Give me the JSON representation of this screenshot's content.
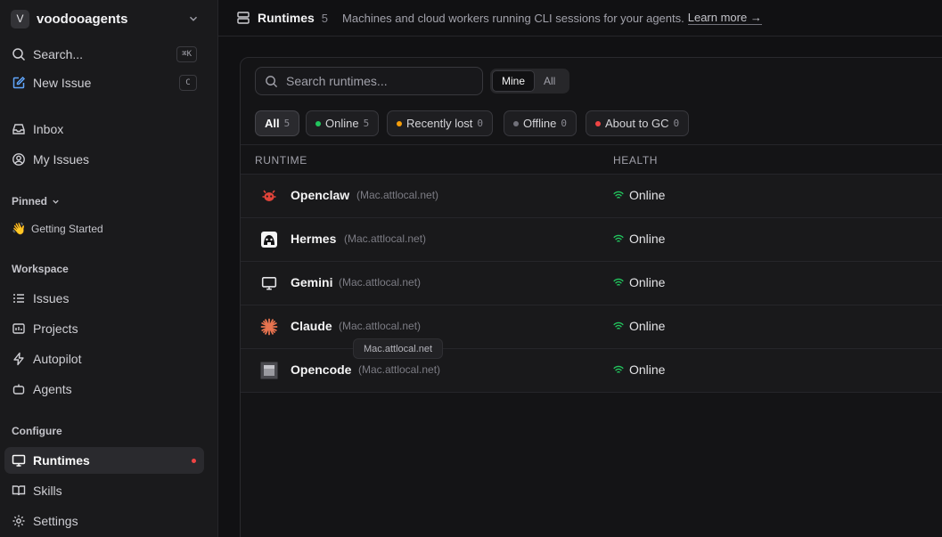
{
  "workspace": {
    "initial": "V",
    "name": "voodooagents"
  },
  "sidebar": {
    "search": {
      "label": "Search...",
      "shortcut": "⌘K"
    },
    "new_issue": {
      "label": "New Issue",
      "shortcut": "C"
    },
    "inbox": "Inbox",
    "my_issues": "My Issues",
    "pinned_label": "Pinned",
    "pinned_items": [
      {
        "emoji": "👋",
        "label": "Getting Started"
      }
    ],
    "workspace_label": "Workspace",
    "workspace_items": [
      "Issues",
      "Projects",
      "Autopilot",
      "Agents"
    ],
    "configure_label": "Configure",
    "configure_items": [
      "Runtimes",
      "Skills",
      "Settings"
    ]
  },
  "header": {
    "title": "Runtimes",
    "count": "5",
    "description": "Machines and cloud workers running CLI sessions for your agents.",
    "link": "Learn more →"
  },
  "toolbar": {
    "search_placeholder": "Search runtimes...",
    "scope": {
      "mine": "Mine",
      "all": "All",
      "selected": "Mine"
    }
  },
  "filters": [
    {
      "label": "All",
      "count": "5",
      "active": true
    },
    {
      "label": "Online",
      "count": "5",
      "color": "#22c55e"
    },
    {
      "label": "Recently lost",
      "count": "0",
      "color": "#f59e0b"
    },
    {
      "label": "Offline",
      "count": "0",
      "color": "#71717a"
    },
    {
      "label": "About to GC",
      "count": "0",
      "color": "#ef4444"
    }
  ],
  "table": {
    "columns": [
      "RUNTIME",
      "HEALTH"
    ],
    "rows": [
      {
        "name": "Openclaw",
        "host": "(Mac.attlocal.net)",
        "health": "Online",
        "icon": "openclaw-icon"
      },
      {
        "name": "Hermes",
        "host": "(Mac.attlocal.net)",
        "health": "Online",
        "icon": "hermes-icon"
      },
      {
        "name": "Gemini",
        "host": "(Mac.attlocal.net)",
        "health": "Online",
        "icon": "monitor-icon"
      },
      {
        "name": "Claude",
        "host": "(Mac.attlocal.net)",
        "health": "Online",
        "icon": "claude-icon"
      },
      {
        "name": "Opencode",
        "host": "(Mac.attlocal.net)",
        "health": "Online",
        "icon": "opencode-icon"
      }
    ]
  },
  "tooltip": "Mac.attlocal.net",
  "colors": {
    "online": "#22c55e",
    "accent_red": "#ef4444",
    "claude": "#e8734f",
    "openclaw": "#e0443a"
  }
}
